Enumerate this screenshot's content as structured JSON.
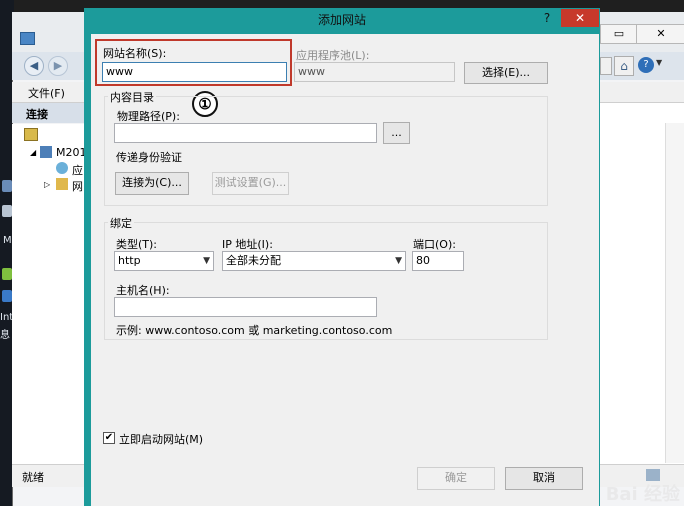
{
  "background_window": {
    "menu": {
      "file": "文件(F)"
    },
    "connections": {
      "header": "连接",
      "tree_root": "M201",
      "tree_child_apps": "应",
      "tree_child_sites": "网"
    },
    "status": "就绪"
  },
  "desktop": {
    "labels": [
      "M",
      "Int",
      "息"
    ]
  },
  "dialog": {
    "title": "添加网站",
    "help": "?",
    "close": "✕",
    "site_name": {
      "label": "网站名称(S):",
      "value": "www"
    },
    "app_pool": {
      "label": "应用程序池(L):",
      "value": "www",
      "select_button": "选择(E)..."
    },
    "annotation_number": "①",
    "content_directory": {
      "group_label": "内容目录",
      "physical_path_label": "物理路径(P):",
      "physical_path_value": "",
      "browse_button": "...",
      "passthrough_label": "传递身份验证",
      "connect_as_button": "连接为(C)...",
      "test_settings_button": "测试设置(G)..."
    },
    "binding": {
      "group_label": "绑定",
      "type_label": "类型(T):",
      "type_value": "http",
      "ip_label": "IP 地址(I):",
      "ip_value": "全部未分配",
      "port_label": "端口(O):",
      "port_value": "80",
      "hostname_label": "主机名(H):",
      "hostname_value": "",
      "example": "示例: www.contoso.com 或 marketing.contoso.com"
    },
    "start_immediately": {
      "label": "立即启动网站(M)",
      "checked": true
    },
    "ok_button": "确定",
    "cancel_button": "取消"
  },
  "watermark": "Bai 经验"
}
